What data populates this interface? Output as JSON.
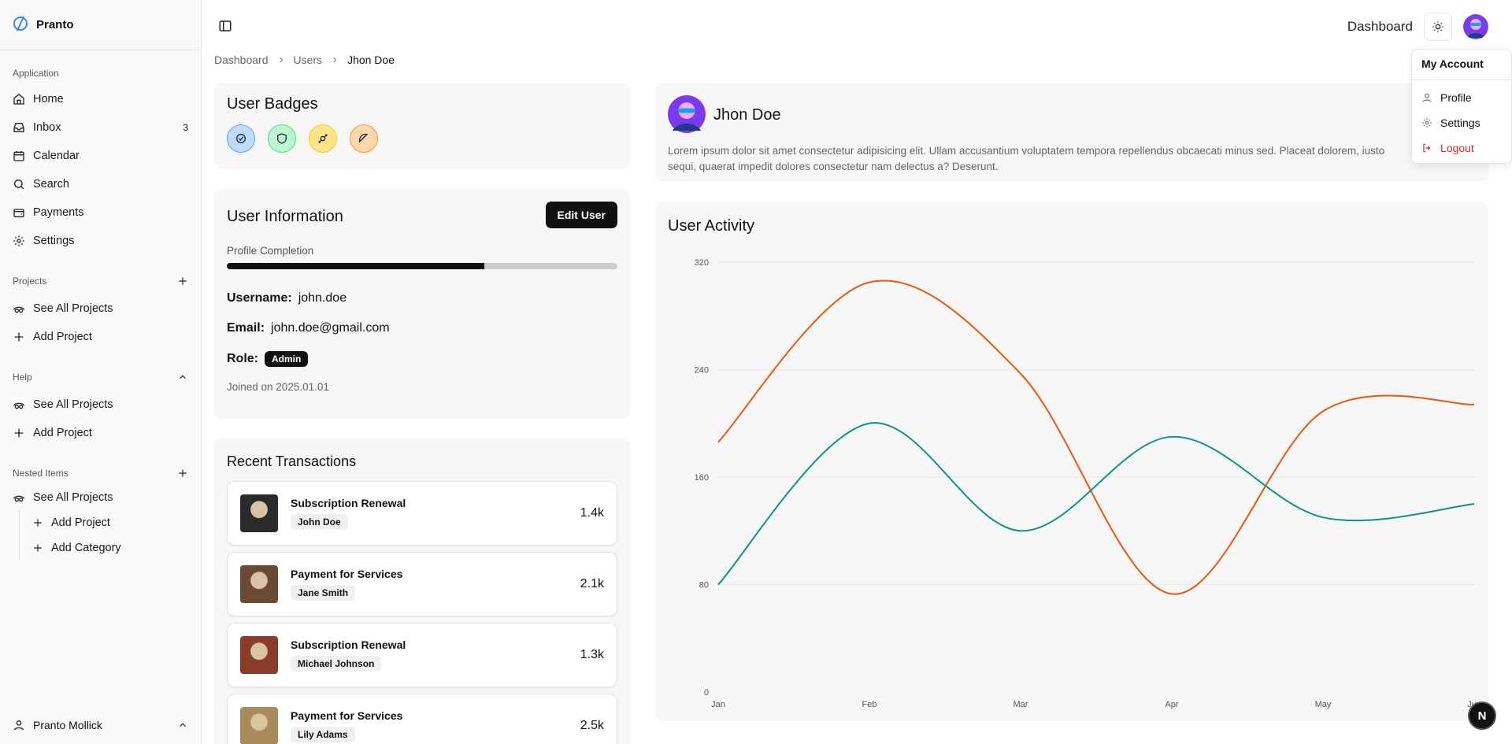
{
  "brand": {
    "name": "Pranto"
  },
  "sidebar": {
    "application_label": "Application",
    "items": [
      {
        "label": "Home",
        "icon": "home-icon"
      },
      {
        "label": "Inbox",
        "icon": "inbox-icon",
        "count": "3"
      },
      {
        "label": "Calendar",
        "icon": "calendar-icon"
      },
      {
        "label": "Search",
        "icon": "search-icon"
      },
      {
        "label": "Payments",
        "icon": "wallet-icon"
      },
      {
        "label": "Settings",
        "icon": "gear-icon"
      }
    ],
    "projects_label": "Projects",
    "projects_items": [
      {
        "label": "See All Projects",
        "icon": "eye-icon"
      },
      {
        "label": "Add Project",
        "icon": "plus-icon"
      }
    ],
    "help_label": "Help",
    "help_items": [
      {
        "label": "See All Projects",
        "icon": "eye-icon"
      },
      {
        "label": "Add Project",
        "icon": "plus-icon"
      }
    ],
    "nested_label": "Nested Items",
    "nested_root": {
      "label": "See All Projects",
      "icon": "eye-icon"
    },
    "nested_children": [
      {
        "label": "Add Project",
        "icon": "plus-icon"
      },
      {
        "label": "Add Category",
        "icon": "plus-icon"
      }
    ],
    "footer_user": "Pranto Mollick"
  },
  "header": {
    "title": "Dashboard"
  },
  "breadcrumb": [
    "Dashboard",
    "Users",
    "Jhon Doe"
  ],
  "badges": {
    "title": "User Badges",
    "items": [
      {
        "icon": "check-icon",
        "bg": "#bfdbfe",
        "border": "#60a5fa"
      },
      {
        "icon": "shield-icon",
        "bg": "#bbf7d0",
        "border": "#4ade80"
      },
      {
        "icon": "candy-icon",
        "bg": "#fde68a",
        "border": "#facc15"
      },
      {
        "icon": "citrus-icon",
        "bg": "#fed7aa",
        "border": "#fb923c"
      }
    ]
  },
  "user_info": {
    "title": "User Information",
    "edit_label": "Edit User",
    "progress_label": "Profile Completion",
    "progress_value": 0.66,
    "username_label": "Username:",
    "username": "john.doe",
    "email_label": "Email:",
    "email": "john.doe@gmail.com",
    "role_label": "Role:",
    "role": "Admin",
    "joined": "Joined on 2025.01.01"
  },
  "transactions": {
    "title": "Recent Transactions",
    "items": [
      {
        "title": "Subscription Renewal",
        "user": "John Doe",
        "amount": "1.4k",
        "thumb": "#2a2a2a"
      },
      {
        "title": "Payment for Services",
        "user": "Jane Smith",
        "amount": "2.1k",
        "thumb": "#6b4a34"
      },
      {
        "title": "Subscription Renewal",
        "user": "Michael Johnson",
        "amount": "1.3k",
        "thumb": "#8a3b2a"
      },
      {
        "title": "Payment for Services",
        "user": "Lily Adams",
        "amount": "2.5k",
        "thumb": "#a98a5a"
      }
    ]
  },
  "profile": {
    "name": "Jhon Doe",
    "description": "Lorem ipsum dolor sit amet consectetur adipisicing elit. Ullam accusantium voluptatem tempora repellendus obcaecati minus sed. Placeat dolorem, iusto sequi, quaerat impedit dolores consectetur nam delectus a? Deserunt."
  },
  "dropdown": {
    "title": "My Account",
    "items": [
      {
        "label": "Profile",
        "icon": "user-icon"
      },
      {
        "label": "Settings",
        "icon": "gear-icon"
      },
      {
        "label": "Logout",
        "icon": "logout-icon"
      }
    ]
  },
  "fab_label": "N",
  "chart_title": "User Activity",
  "chart_data": {
    "type": "line",
    "title": "User Activity",
    "categories": [
      "Jan",
      "Feb",
      "Mar",
      "Apr",
      "May",
      "Jun"
    ],
    "series": [
      {
        "values": [
          186,
          305,
          237,
          73,
          209,
          214
        ],
        "color": "#ea580c"
      },
      {
        "values": [
          80,
          200,
          120,
          190,
          130,
          140
        ],
        "color": "#0d9488"
      }
    ],
    "y_ticks": [
      0,
      80,
      160,
      240,
      320
    ],
    "ylim": [
      0,
      320
    ],
    "grid": true
  }
}
